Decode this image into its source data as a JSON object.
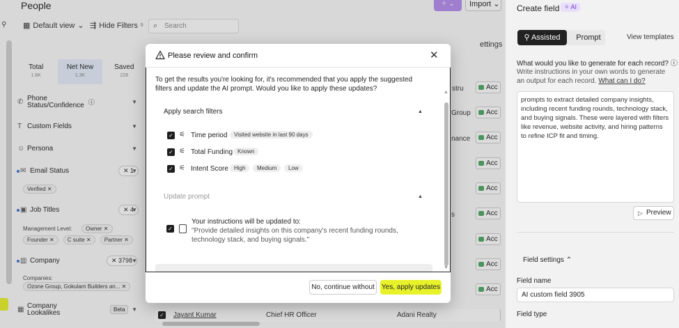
{
  "app": {
    "page_title": "People",
    "ai_button_label": "✧ ⌄",
    "import_label": "Import ⌄"
  },
  "toolbar": {
    "default_view": "Default view",
    "hide_filters": "Hide Filters",
    "hide_filters_count": "6",
    "search_placeholder": "Search",
    "settings_label": "ettings"
  },
  "sidebar": {
    "tabs": [
      {
        "label": "Total",
        "count": "1.6K"
      },
      {
        "label": "Net New",
        "count": "1.3K"
      },
      {
        "label": "Saved",
        "count": "228"
      }
    ],
    "filters": {
      "phone_line1": "Phone",
      "phone_line2": "Status/Confidence",
      "custom_fields": "Custom Fields",
      "persona": "Persona",
      "email_status": "Email Status",
      "email_count": "1",
      "email_chip": "Verified",
      "job_titles": "Job Titles",
      "job_count": "4",
      "management_level_label": "Management Level:",
      "job_chips": [
        "Owner",
        "Founder",
        "C suite",
        "Partner"
      ],
      "company": "Company",
      "company_count": "3798",
      "companies_label": "Companies:",
      "companies_chip": "Ozone Group, Gokulam Builders an...",
      "lookalikes_line1": "Company",
      "lookalikes_line2": "Lookalikes",
      "beta": "Beta"
    }
  },
  "table": {
    "cells": [
      "stru",
      "Group",
      "nance",
      "s"
    ],
    "acc_label": "Acc",
    "bottom_row": {
      "name": "Jayant Kumar",
      "title": "Chief HR Officer",
      "company": "Adani Realty"
    }
  },
  "right_panel": {
    "title": "Create field",
    "ai_badge": "AI",
    "mode_assisted": "Assisted",
    "mode_prompt": "Prompt",
    "view_templates": "View templates",
    "question": "What would you like to generate for each record?",
    "help_text": "Write instructions in your own words to generate an output for each record.",
    "help_link": "What can I do?",
    "prompt_text": "prompts to extract detailed company insights, including recent funding rounds, technology stack, and buying signals. These were layered with filters like revenue, website activity, and hiring patterns to refine ICP fit and timing.",
    "preview": "Preview",
    "field_settings": "Field settings",
    "field_name_label": "Field name",
    "field_name_value": "AI custom field 3905",
    "field_type_label": "Field type"
  },
  "modal": {
    "title": "Please review and confirm",
    "intro": "To get the results you're looking for, it's recommended that you apply the suggested filters and update the AI prompt. Would you like to apply these updates?",
    "filters_section": "Apply search filters",
    "filters": [
      {
        "label": "Time period",
        "tags": [
          "Visited website in last 90 days"
        ]
      },
      {
        "label": "Total Funding",
        "tags": [
          "Known"
        ]
      },
      {
        "label": "Intent Score",
        "tags": [
          "High",
          "Medium",
          "Low"
        ]
      }
    ],
    "prompt_section": "Update prompt",
    "update_title": "Your instructions will be updated to:",
    "update_text": "\"Provide detailed insights on this company's recent funding rounds, technology stack, and buying signals.\"",
    "no_button": "No, continue without",
    "yes_button": "Yes, apply updates"
  }
}
